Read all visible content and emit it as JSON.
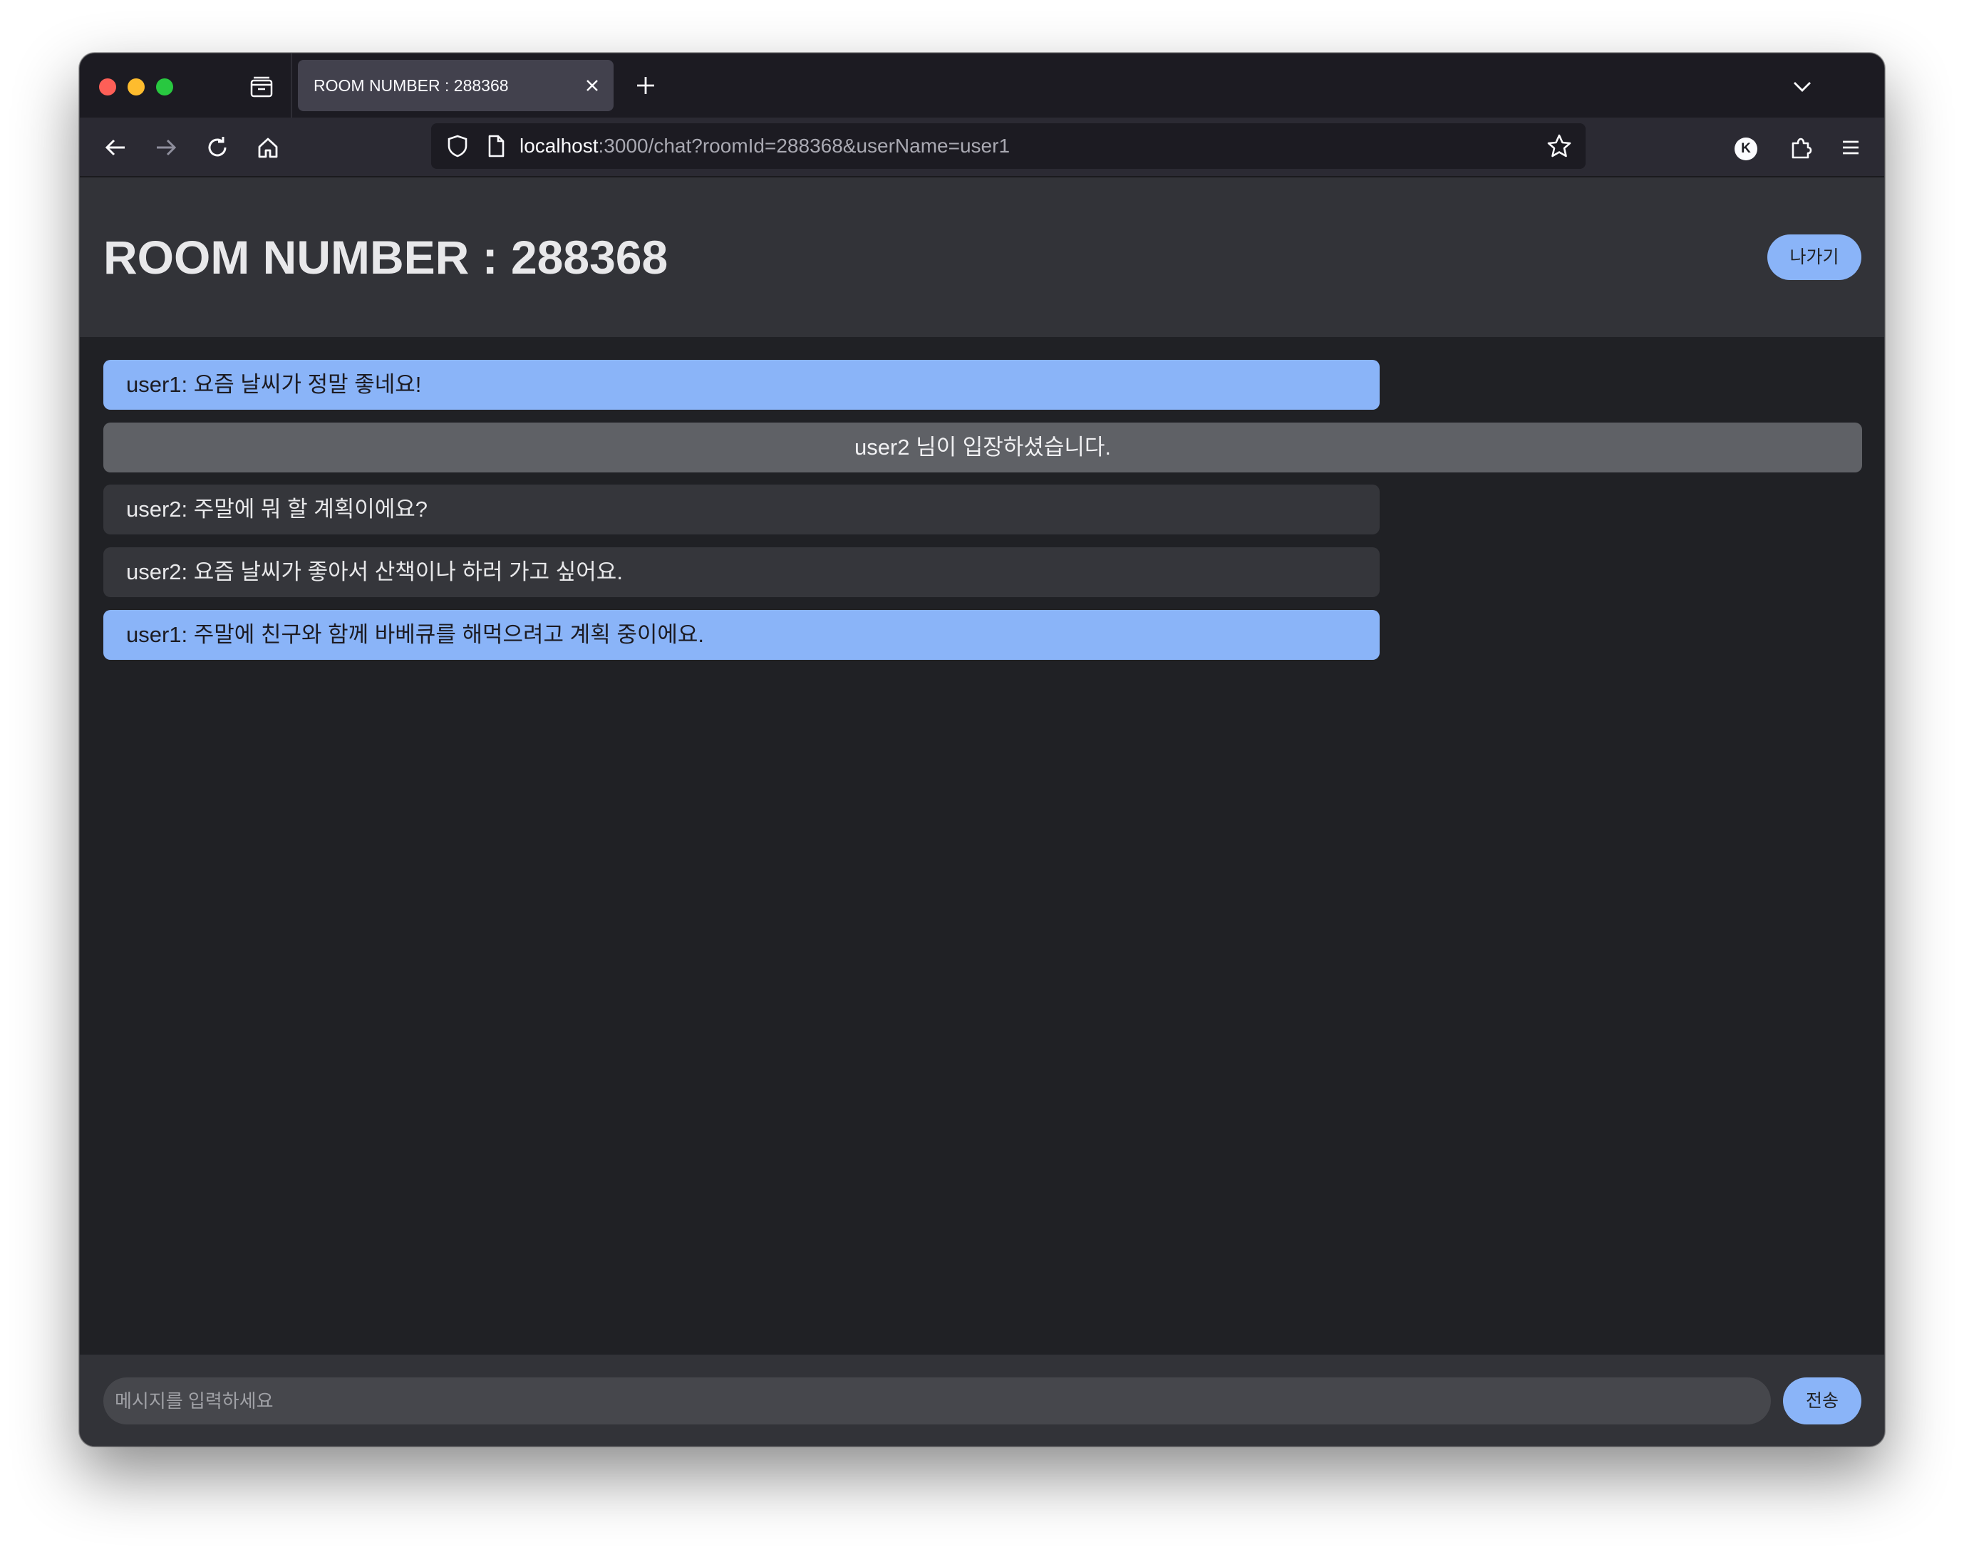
{
  "browser": {
    "tab_title": "ROOM NUMBER : 288368",
    "url_host": "localhost",
    "url_rest": ":3000/chat?roomId=288368&userName=user1",
    "account_initial": "K"
  },
  "page": {
    "title": "ROOM NUMBER : 288368",
    "leave_label": "나가기",
    "messages": [
      {
        "type": "mine",
        "text": "user1: 요즘 날씨가 정말 좋네요!"
      },
      {
        "type": "system",
        "text": "user2 님이 입장하셨습니다."
      },
      {
        "type": "other",
        "text": "user2: 주말에 뭐 할 계획이에요?"
      },
      {
        "type": "other",
        "text": "user2: 요즘 날씨가 좋아서 산책이나 하러 가고 싶어요."
      },
      {
        "type": "mine",
        "text": "user1: 주말에 친구와 함께 바베큐를 해먹으려고 계획 중이에요."
      }
    ],
    "input_placeholder": "메시지를 입력하세요",
    "input_value": "",
    "send_label": "전송"
  },
  "colors": {
    "accent": "#8ab4f8",
    "page_bg": "#202125",
    "header_bg": "#323338",
    "system_msg_bg": "#5f6166",
    "other_msg_bg": "#35363b"
  }
}
